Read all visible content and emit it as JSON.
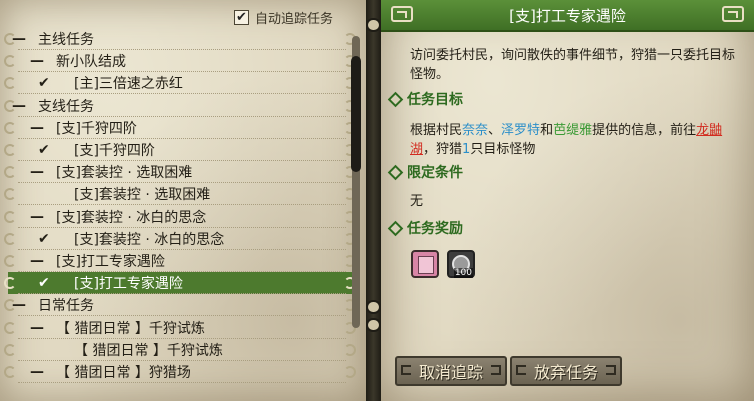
{
  "auto_track": {
    "label": "自动追踪任务",
    "checked": true
  },
  "quest_list": [
    {
      "mark": "—",
      "indent": 0,
      "label": "主线任务",
      "type": "category"
    },
    {
      "mark": "—",
      "indent": 1,
      "label": "新小队结成",
      "type": "group"
    },
    {
      "mark": "✔",
      "indent": 2,
      "label": "[主]三倍速之赤红",
      "type": "quest"
    },
    {
      "mark": "—",
      "indent": 0,
      "label": "支线任务",
      "type": "category"
    },
    {
      "mark": "—",
      "indent": 1,
      "label": "[支]千狩四阶",
      "type": "group"
    },
    {
      "mark": "✔",
      "indent": 2,
      "label": "[支]千狩四阶",
      "type": "quest"
    },
    {
      "mark": "—",
      "indent": 1,
      "label": "[支]套装控 · 选取困难",
      "type": "group"
    },
    {
      "mark": "",
      "indent": 2,
      "label": "[支]套装控 · 选取困难",
      "type": "quest"
    },
    {
      "mark": "—",
      "indent": 1,
      "label": "[支]套装控 · 冰白的思念",
      "type": "group"
    },
    {
      "mark": "✔",
      "indent": 2,
      "label": "[支]套装控 · 冰白的思念",
      "type": "quest"
    },
    {
      "mark": "—",
      "indent": 1,
      "label": "[支]打工专家遇险",
      "type": "group"
    },
    {
      "mark": "✔",
      "indent": 2,
      "label": "[支]打工专家遇险",
      "type": "quest",
      "selected": true
    },
    {
      "mark": "—",
      "indent": 0,
      "label": "日常任务",
      "type": "category"
    },
    {
      "mark": "—",
      "indent": 1,
      "label": "【 猎团日常 】千狩试炼",
      "type": "group"
    },
    {
      "mark": "",
      "indent": 2,
      "label": "【 猎团日常 】千狩试炼",
      "type": "quest"
    },
    {
      "mark": "—",
      "indent": 1,
      "label": "【 猎团日常 】狩猎场",
      "type": "group"
    }
  ],
  "detail": {
    "title": "[支]打工专家遇险",
    "description": "访问委托村民，询问散佚的事件细节，狩猎一只委托目标怪物。",
    "objective_title": "任务目标",
    "objective": {
      "p1": "根据村民",
      "npc1": "奈奈",
      "sep1": "、",
      "npc2": "泽罗特",
      "and": "和",
      "npc3": "芭缇雅",
      "p2": "提供的信息，前往",
      "place": "龙鼬湖",
      "p3": "，狩猎",
      "count": "1",
      "p4": "只目标怪物"
    },
    "condition_title": "限定条件",
    "condition": "无",
    "reward_title": "任务奖励",
    "rewards": [
      {
        "icon": "scroll-item-icon",
        "qty": ""
      },
      {
        "icon": "coin-item-icon",
        "qty": "100"
      }
    ]
  },
  "buttons": {
    "untrack": "取消追踪",
    "abandon": "放弃任务"
  },
  "colors": {
    "selected_row": "#4d7a2e",
    "header": "#4a7d2e",
    "section_title": "#2d6a1f",
    "npc_blue": "#2c8fc9",
    "npc_green": "#3b9a35",
    "place_red": "#d22b1f"
  }
}
